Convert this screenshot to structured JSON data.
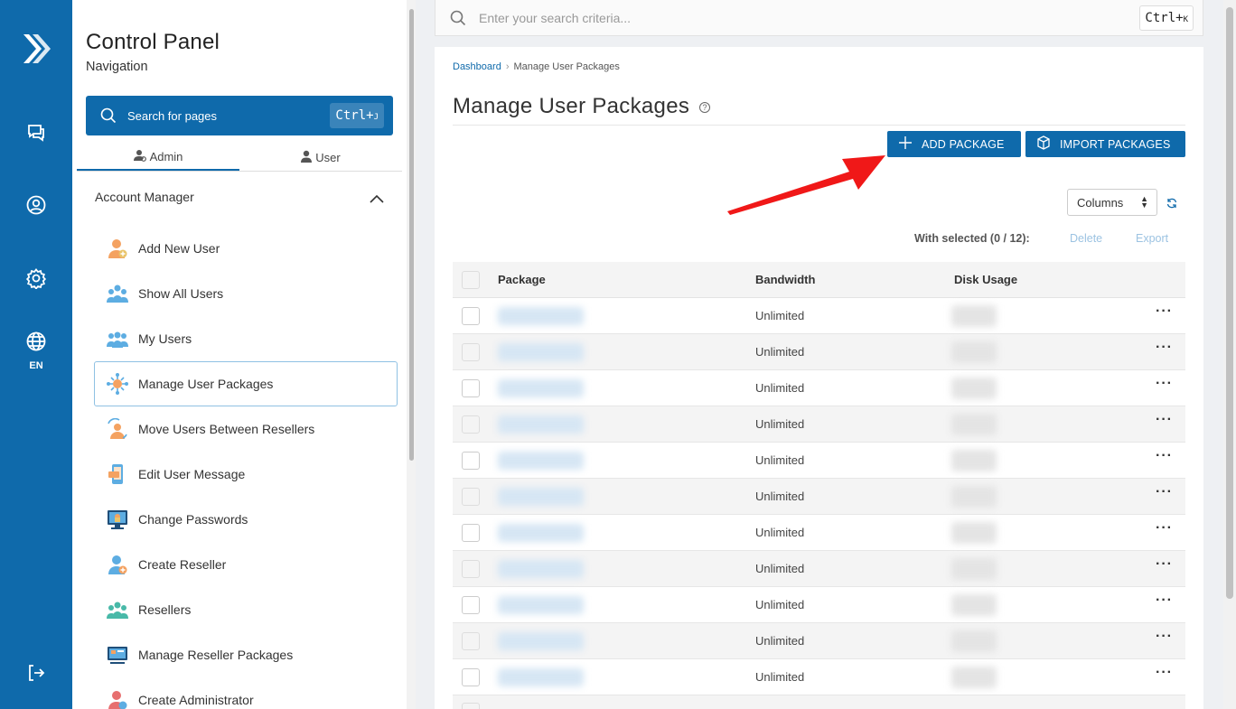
{
  "rail": {
    "lang": "EN",
    "icons": [
      "logo-icon",
      "chat-icon",
      "user-circle-icon",
      "settings-icon",
      "globe-icon",
      "logout-icon"
    ]
  },
  "sidebar": {
    "title": "Control Panel",
    "subtitle": "Navigation",
    "search_placeholder": "Search for pages",
    "search_kbd": "Ctrl+",
    "search_kbd_key": "J",
    "tabs": [
      {
        "label": "Admin",
        "active": true
      },
      {
        "label": "User",
        "active": false
      }
    ],
    "section": "Account Manager",
    "items": [
      {
        "label": "Add New User",
        "icon": "add-user-icon",
        "active": false
      },
      {
        "label": "Show All Users",
        "icon": "users-icon",
        "active": false
      },
      {
        "label": "My Users",
        "icon": "my-users-icon",
        "active": false
      },
      {
        "label": "Manage User Packages",
        "icon": "packages-icon",
        "active": true
      },
      {
        "label": "Move Users Between Resellers",
        "icon": "move-users-icon",
        "active": false
      },
      {
        "label": "Edit User Message",
        "icon": "message-icon",
        "active": false
      },
      {
        "label": "Change Passwords",
        "icon": "password-icon",
        "active": false
      },
      {
        "label": "Create Reseller",
        "icon": "create-reseller-icon",
        "active": false
      },
      {
        "label": "Resellers",
        "icon": "resellers-icon",
        "active": false
      },
      {
        "label": "Manage Reseller Packages",
        "icon": "reseller-packages-icon",
        "active": false
      },
      {
        "label": "Create Administrator",
        "icon": "create-admin-icon",
        "active": false
      }
    ]
  },
  "topsearch": {
    "placeholder": "Enter your search criteria...",
    "kbd": "Ctrl+",
    "kbd_key": "K"
  },
  "main": {
    "breadcrumb": [
      "Dashboard",
      "Manage User Packages"
    ],
    "title": "Manage User Packages",
    "add_button": "ADD PACKAGE",
    "import_button": "IMPORT PACKAGES",
    "columns_select": "Columns",
    "with_selected": "With selected (0 / 12):",
    "delete": "Delete",
    "export": "Export",
    "table": {
      "headers": [
        "Package",
        "Bandwidth",
        "Disk Usage"
      ],
      "rows": [
        {
          "bandwidth": "Unlimited"
        },
        {
          "bandwidth": "Unlimited"
        },
        {
          "bandwidth": "Unlimited"
        },
        {
          "bandwidth": "Unlimited"
        },
        {
          "bandwidth": "Unlimited"
        },
        {
          "bandwidth": "Unlimited"
        },
        {
          "bandwidth": "Unlimited"
        },
        {
          "bandwidth": "Unlimited"
        },
        {
          "bandwidth": "Unlimited"
        },
        {
          "bandwidth": "Unlimited"
        },
        {
          "bandwidth": "Unlimited"
        }
      ]
    }
  },
  "colors": {
    "brand": "#0f6aab",
    "arrow": "#f01818"
  }
}
